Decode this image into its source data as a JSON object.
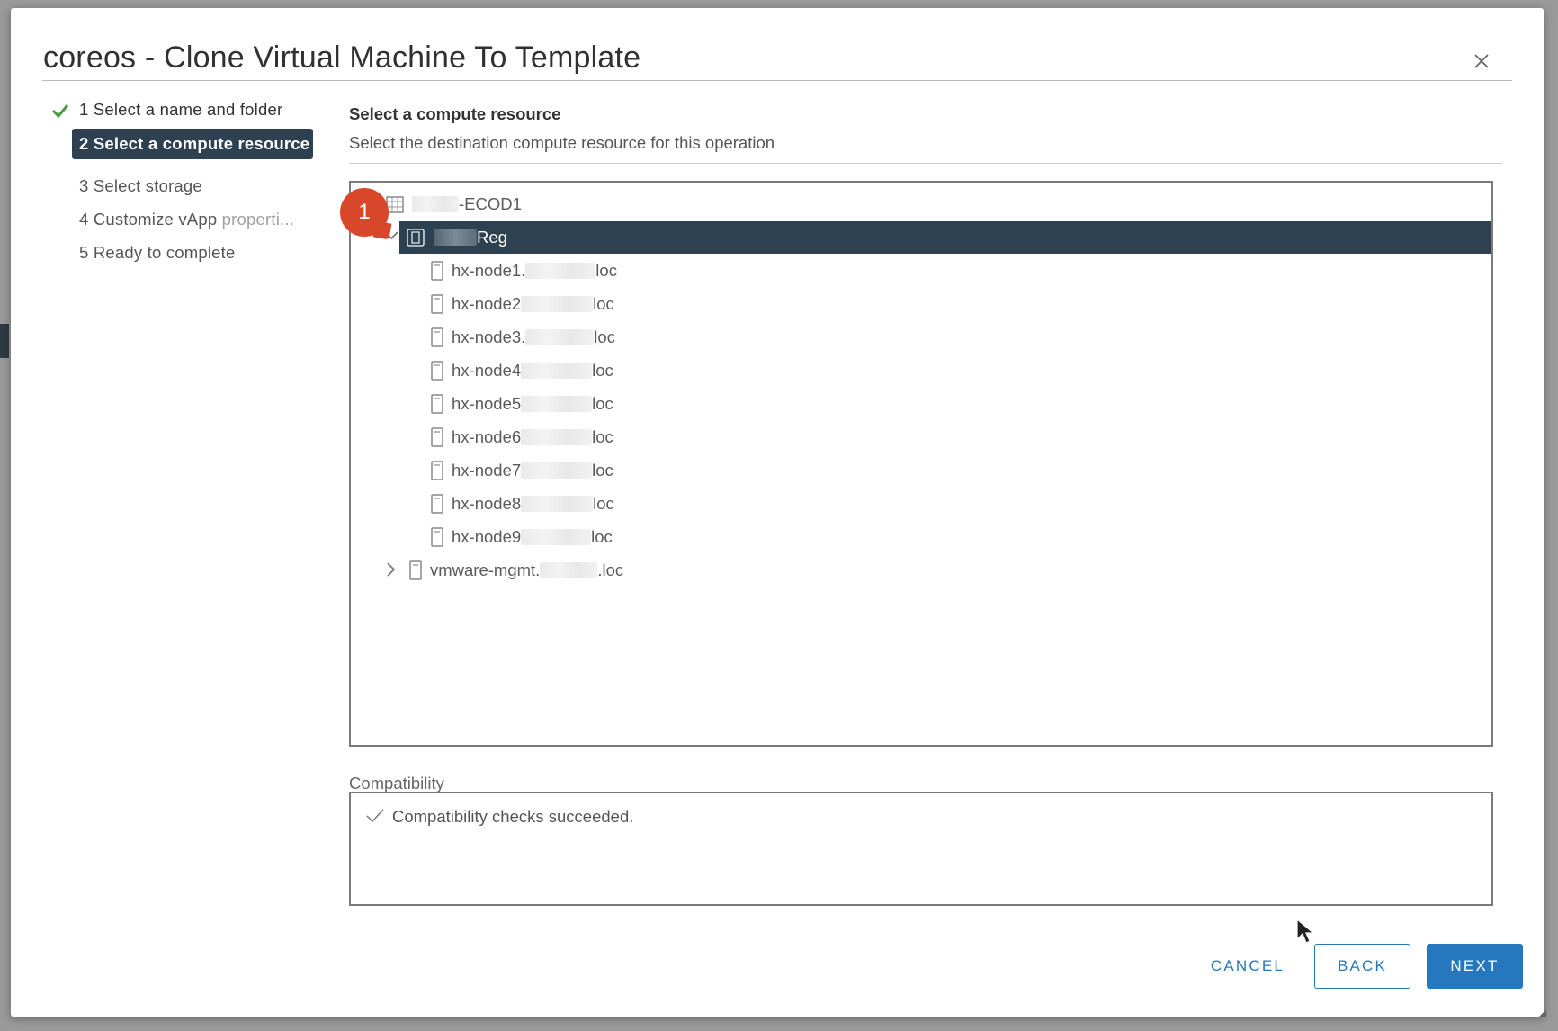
{
  "dialog": {
    "title": "coreos - Clone Virtual Machine To Template",
    "close_icon": "close-icon"
  },
  "steps": [
    {
      "label": "1 Select a name and folder",
      "state": "done"
    },
    {
      "label": "2 Select a compute resource",
      "state": "active"
    },
    {
      "label": "3 Select storage",
      "state": "pending"
    },
    {
      "label": "4 Customize vApp properti...",
      "state": "pending"
    },
    {
      "label": "5 Ready to complete",
      "state": "pending"
    }
  ],
  "pane": {
    "title": "Select a compute resource",
    "subtitle": "Select the destination compute resource for this operation"
  },
  "callout_badge": "1",
  "tree": {
    "datacenter": {
      "label": "-ECOD1",
      "icon": "datacenter-icon"
    },
    "cluster": {
      "label": "Reg",
      "icon": "cluster-icon",
      "expanded": true,
      "selected": true
    },
    "hosts": [
      {
        "prefix": "hx-node1.",
        "suffix": "loc"
      },
      {
        "prefix": "hx-node2",
        "suffix": "loc"
      },
      {
        "prefix": "hx-node3.",
        "suffix": "loc"
      },
      {
        "prefix": "hx-node4",
        "suffix": "loc"
      },
      {
        "prefix": "hx-node5",
        "suffix": "loc"
      },
      {
        "prefix": "hx-node6",
        "suffix": "loc"
      },
      {
        "prefix": "hx-node7",
        "suffix": "loc"
      },
      {
        "prefix": "hx-node8",
        "suffix": "loc"
      },
      {
        "prefix": "hx-node9",
        "suffix": "loc"
      }
    ],
    "other_host": {
      "prefix": "vmware-mgmt.",
      "suffix": ".loc",
      "expanded": false
    }
  },
  "compatibility": {
    "label": "Compatibility",
    "message": "Compatibility checks succeeded."
  },
  "buttons": {
    "cancel": "CANCEL",
    "back": "BACK",
    "next": "NEXT"
  },
  "colors": {
    "selected_bg": "#2d4150",
    "primary": "#2678be",
    "badge": "#d9472b",
    "success": "#4a9b3f"
  }
}
